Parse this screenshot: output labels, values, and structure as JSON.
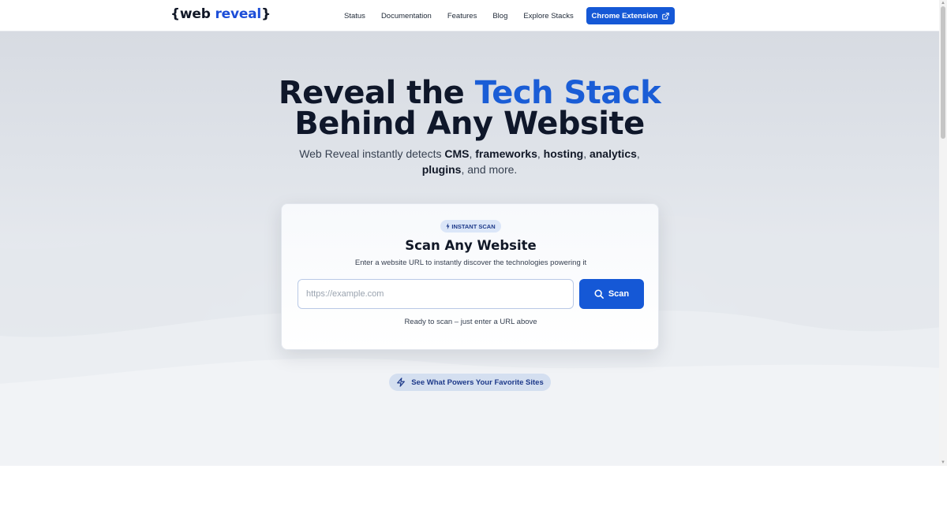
{
  "brand": {
    "open_brace": "{",
    "word1": "web",
    "word2": "reveal",
    "close_brace": "}",
    "accent_color": "#1558d6"
  },
  "nav": {
    "items": [
      {
        "label": "Status"
      },
      {
        "label": "Documentation"
      },
      {
        "label": "Features"
      },
      {
        "label": "Blog"
      },
      {
        "label": "Explore Stacks"
      }
    ],
    "cta_label": "Chrome Extension",
    "cta_icon": "external-link-icon"
  },
  "hero": {
    "line1_a": "Reveal the ",
    "line1_b": "Tech Stack",
    "line2": "Behind Any Website",
    "sub": {
      "t1": "Web Reveal instantly detects ",
      "b1": "CMS",
      "t2": ", ",
      "b2": "frameworks",
      "t3": ", ",
      "b3": "hosting",
      "t4": ", ",
      "b4": "analytics",
      "t5": ", ",
      "b5": "plugins",
      "t6": ", and more."
    }
  },
  "scan_card": {
    "badge": "INSTANT SCAN",
    "badge_icon": "bolt-icon",
    "title": "Scan Any Website",
    "subtitle": "Enter a website URL to instantly discover the technologies powering it",
    "input_placeholder": "https://example.com",
    "input_value": "",
    "button_label": "Scan",
    "button_icon": "search-icon",
    "status": "Ready to scan – just enter a URL above"
  },
  "showcase_link": {
    "label": "See What Powers Your Favorite Sites",
    "icon": "lightning-icon"
  }
}
